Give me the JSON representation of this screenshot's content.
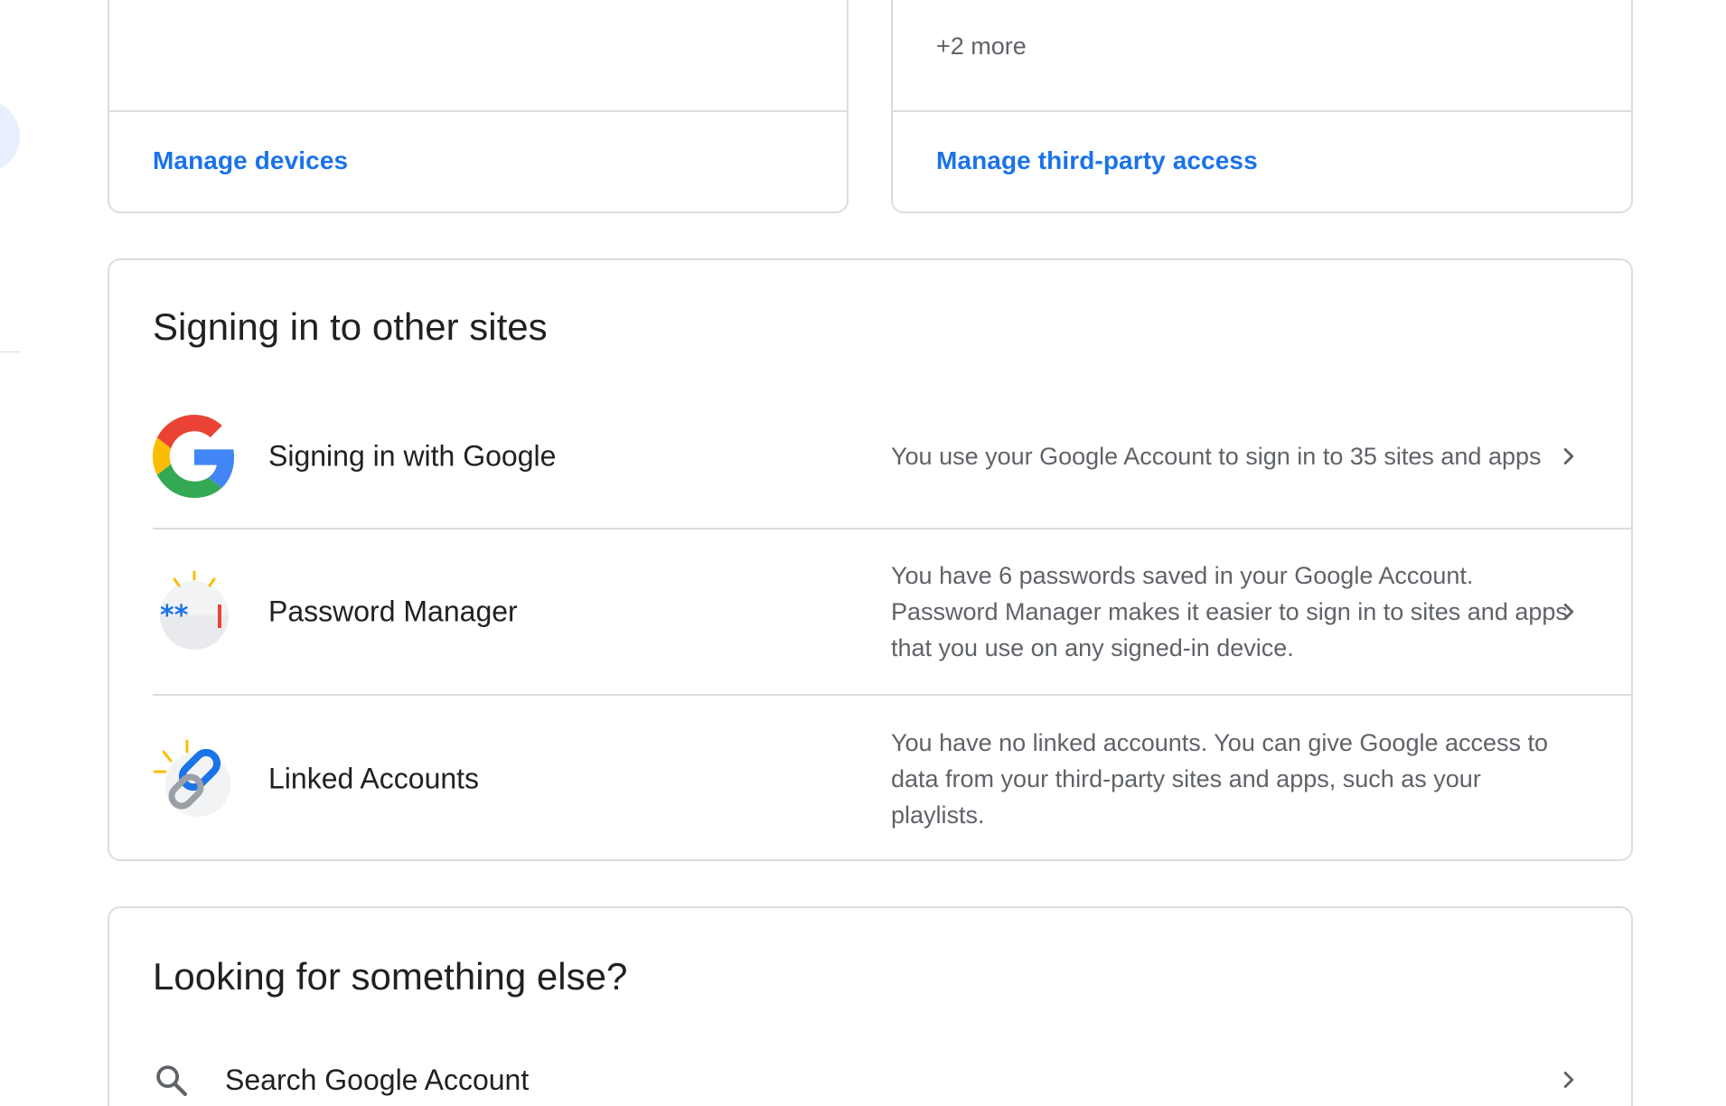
{
  "top_cards": {
    "devices": {
      "link_label": "Manage devices"
    },
    "third_party": {
      "more_text": "+2 more",
      "link_label": "Manage third-party access"
    }
  },
  "signing_section": {
    "title": "Signing in to other sites",
    "rows": [
      {
        "icon": "google-g-icon",
        "label": "Signing in with Google",
        "description": "You use your Google Account to sign in to 35 sites and apps"
      },
      {
        "icon": "password-manager-icon",
        "label": "Password Manager",
        "description": "You have 6 passwords saved in your Google Account. Password Manager makes it easier to sign in to sites and apps that you use on any signed-in device."
      },
      {
        "icon": "linked-accounts-icon",
        "label": "Linked Accounts",
        "description": "You have no linked accounts. You can give Google access to data from your third-party sites and apps, such as your playlists."
      }
    ]
  },
  "else_section": {
    "title": "Looking for something else?",
    "search_label": "Search Google Account"
  },
  "colors": {
    "link": "#1a73e8",
    "border": "#dadce0",
    "secondary_text": "#5f6368",
    "primary_text": "#202124"
  }
}
